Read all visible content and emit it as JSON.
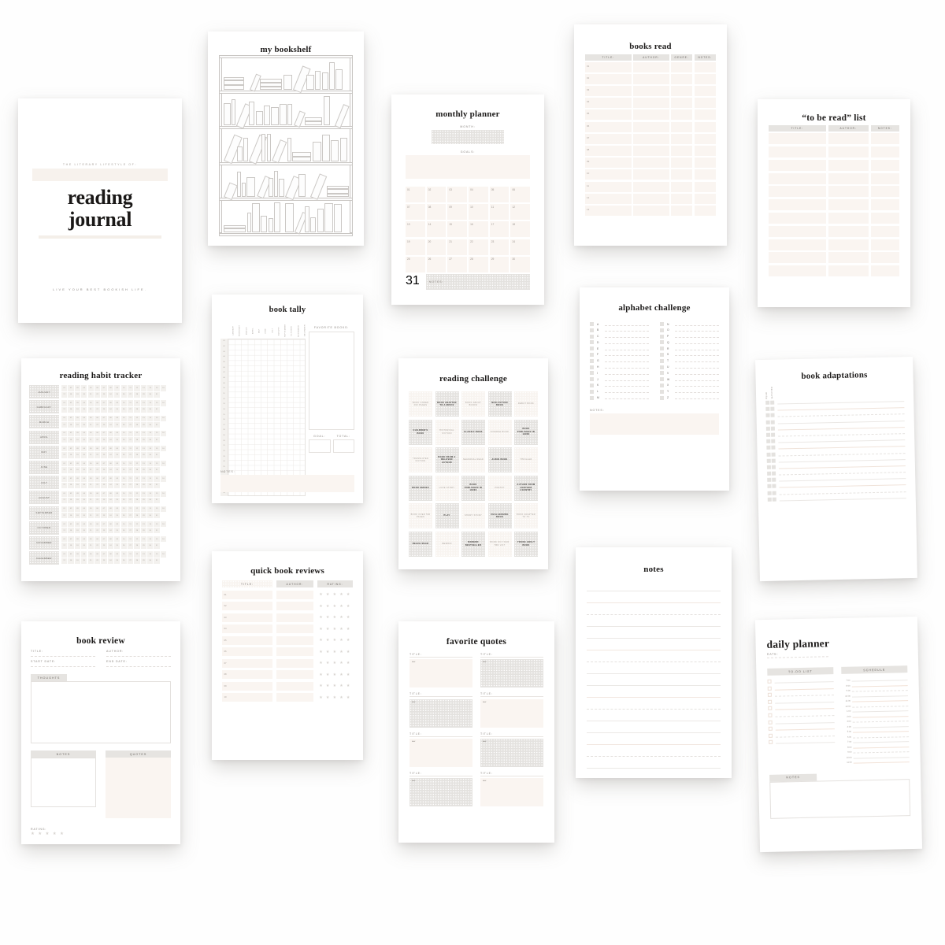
{
  "meta": {
    "background": "#fefefe",
    "page_bg": "#ffffff",
    "ink": "#1d1b1a",
    "cream": "#faf5f1",
    "grey": "#e6e4e1"
  },
  "cover": {
    "eyebrow": "THE LITERARY LIFESTYLE OF:",
    "title_line1": "reading",
    "title_line2": "journal",
    "footer": "LIVE YOUR BEST BOOKISH LIFE."
  },
  "bookshelf": {
    "title": "my bookshelf",
    "shelf_count": 5
  },
  "monthly_planner": {
    "title": "monthly planner",
    "month_label": "MONTH:",
    "goals_label": "GOALS:",
    "notes_label": "NOTES:",
    "days": [
      "01",
      "02",
      "03",
      "04",
      "05",
      "06",
      "07",
      "08",
      "09",
      "10",
      "11",
      "12",
      "13",
      "14",
      "15",
      "16",
      "17",
      "18",
      "19",
      "20",
      "21",
      "22",
      "23",
      "24",
      "25",
      "26",
      "27",
      "28",
      "29",
      "30",
      "31"
    ]
  },
  "books_read": {
    "title": "books read",
    "columns": [
      "TITLE:",
      "AUTHOR:",
      "GENRE:",
      "NOTES:"
    ],
    "rows": [
      "01",
      "02",
      "03",
      "04",
      "05",
      "06",
      "07",
      "08",
      "09",
      "10",
      "11",
      "12",
      "13"
    ]
  },
  "tbr_list": {
    "title": "“to be read” list",
    "columns": [
      "TITLE:",
      "AUTHOR:",
      "NOTES:"
    ],
    "row_count": 11
  },
  "habit_tracker": {
    "title": "reading  habit tracker",
    "months": [
      "JANUARY",
      "FEBRUARY",
      "MARCH",
      "APRIL",
      "MAY",
      "JUNE",
      "JULY",
      "AUGUST",
      "SEPTEMBER",
      "OCTOBER",
      "NOVEMBER",
      "DECEMBER"
    ],
    "days_row1": [
      "01",
      "02",
      "03",
      "04",
      "05",
      "06",
      "07",
      "08",
      "09",
      "10",
      "11",
      "12",
      "13",
      "14",
      "15",
      "16"
    ],
    "days_row2": [
      "17",
      "18",
      "19",
      "20",
      "21",
      "22",
      "23",
      "24",
      "25",
      "26",
      "27",
      "28",
      "29",
      "30",
      "31"
    ]
  },
  "book_tally": {
    "title": "book tally",
    "favorite_label": "FAVORITE BOOKS:",
    "goal_label": "GOAL:",
    "total_label": "TOTAL:",
    "notes_label": "NOTES:",
    "columns": [
      "JANUARY",
      "FEBRUARY",
      "MARCH",
      "APRIL",
      "MAY",
      "JUNE",
      "JULY",
      "AUGUST",
      "SEPTEMBER",
      "OCTOBER",
      "NOVEMBER",
      "DECEMBER"
    ],
    "row_numbers": [
      "01",
      "02",
      "03",
      "04",
      "05",
      "06",
      "07",
      "08",
      "09",
      "10",
      "11",
      "12",
      "13",
      "14",
      "15",
      "16",
      "17",
      "18",
      "19",
      "20",
      "21",
      "22",
      "23",
      "24",
      "25",
      "26",
      "27",
      "28",
      "29",
      "30"
    ]
  },
  "reading_challenge": {
    "title": "reading challenge",
    "cells": [
      {
        "label": "BOOK UNDER 200 PAGES",
        "tone": "light"
      },
      {
        "label": "BOOK ADAPTED TO A MOVIE",
        "tone": "dark"
      },
      {
        "label": "BOOK ABOUT BOOKS",
        "tone": "light"
      },
      {
        "label": "NON-FICTION BOOK",
        "tone": "dark"
      },
      {
        "label": "DEBUT BOOK",
        "tone": "light"
      },
      {
        "label": "CHILDREN'S BOOK",
        "tone": "dark"
      },
      {
        "label": "HISTORICAL FICTION",
        "tone": "light"
      },
      {
        "label": "CLASSIC BOOK",
        "tone": "dark"
      },
      {
        "label": "DIVERSE BOOK",
        "tone": "light"
      },
      {
        "label": "BOOK PUBLISHED IN 1900S",
        "tone": "dark"
      },
      {
        "label": "TRANSLATED FICTION",
        "tone": "light"
      },
      {
        "label": "BOOK FROM A BELOVED AUTHOR",
        "tone": "dark"
      },
      {
        "label": "SEASONAL READ",
        "tone": "light"
      },
      {
        "label": "AUDIO BOOK",
        "tone": "dark"
      },
      {
        "label": "THRILLER",
        "tone": "light"
      },
      {
        "label": "BOOK SERIES",
        "tone": "dark"
      },
      {
        "label": "LOVE STORY",
        "tone": "light"
      },
      {
        "label": "BOOK PUBLISHED IN 1800S",
        "tone": "dark"
      },
      {
        "label": "POETRY",
        "tone": "light"
      },
      {
        "label": "AUTHOR FROM ANOTHER COUNTRY",
        "tone": "dark"
      },
      {
        "label": "BOOK OVER 500 PAGES",
        "tone": "light"
      },
      {
        "label": "PLAY",
        "tone": "dark"
      },
      {
        "label": "SHORT STORY",
        "tone": "light"
      },
      {
        "label": "CHALLENGING BOOK",
        "tone": "dark"
      },
      {
        "label": "BOOK ADAPTED TO TV",
        "tone": "light"
      },
      {
        "label": "BEACH READ",
        "tone": "dark"
      },
      {
        "label": "MEMOIR",
        "tone": "light"
      },
      {
        "label": "MODERN BESTSELLER",
        "tone": "dark"
      },
      {
        "label": "BOOK ON YOUR TBR LIST",
        "tone": "light"
      },
      {
        "label": "YOUNG ADULT BOOK",
        "tone": "dark"
      }
    ]
  },
  "alphabet_challenge": {
    "title": "alphabet challenge",
    "notes_label": "NOTES:",
    "left": [
      "A",
      "B",
      "C",
      "D",
      "E",
      "F",
      "G",
      "H",
      "I",
      "J",
      "K",
      "L",
      "M"
    ],
    "right": [
      "N",
      "O",
      "P",
      "Q",
      "R",
      "S",
      "T",
      "U",
      "V",
      "W",
      "X",
      "Y",
      "Z"
    ]
  },
  "book_adaptations": {
    "title": "book adaptations",
    "col_read": "READ",
    "col_watched": "WATCHED",
    "row_count": 16
  },
  "book_review": {
    "title": "book review",
    "title_label": "TITLE:",
    "author_label": "AUTHOR:",
    "start_label": "START DATE:",
    "end_label": "END DATE:",
    "thoughts_label": "THOUGHTS",
    "notes_label": "NOTES",
    "quotes_label": "QUOTES",
    "rating_label": "RATING:",
    "stars": "★ ★ ★ ★ ★"
  },
  "quick_reviews": {
    "title": "quick book reviews",
    "columns": [
      "TITLE:",
      "AUTHOR:",
      "RATING:"
    ],
    "rows": [
      "01",
      "02",
      "03",
      "04",
      "05",
      "06",
      "07",
      "08",
      "09",
      "10"
    ],
    "stars": "★ ★ ★ ★ ★"
  },
  "favorite_quotes": {
    "title": "favorite quotes",
    "title_label": "TITLE:",
    "quote_mark": "“",
    "blocks": [
      {
        "tone": "cream"
      },
      {
        "tone": "grey"
      },
      {
        "tone": "grey"
      },
      {
        "tone": "cream"
      },
      {
        "tone": "cream"
      },
      {
        "tone": "grey"
      },
      {
        "tone": "grey"
      },
      {
        "tone": "cream"
      }
    ]
  },
  "notes_page": {
    "title": "notes",
    "line_count": 16
  },
  "daily_planner": {
    "title": "daily planner",
    "date_label": "DATE:",
    "todo_label": "TO-DO LIST",
    "schedule_label": "SCHEDULE",
    "notes_label": "NOTES",
    "todo_count": 10,
    "times": [
      "7:00",
      "8:00",
      "9:00",
      "10:00",
      "11:00",
      "12:00",
      "1:00",
      "2:00",
      "3:00",
      "4:00",
      "5:00",
      "6:00",
      "7:00",
      "8:00",
      "9:00",
      "10:00",
      "11:00"
    ]
  }
}
